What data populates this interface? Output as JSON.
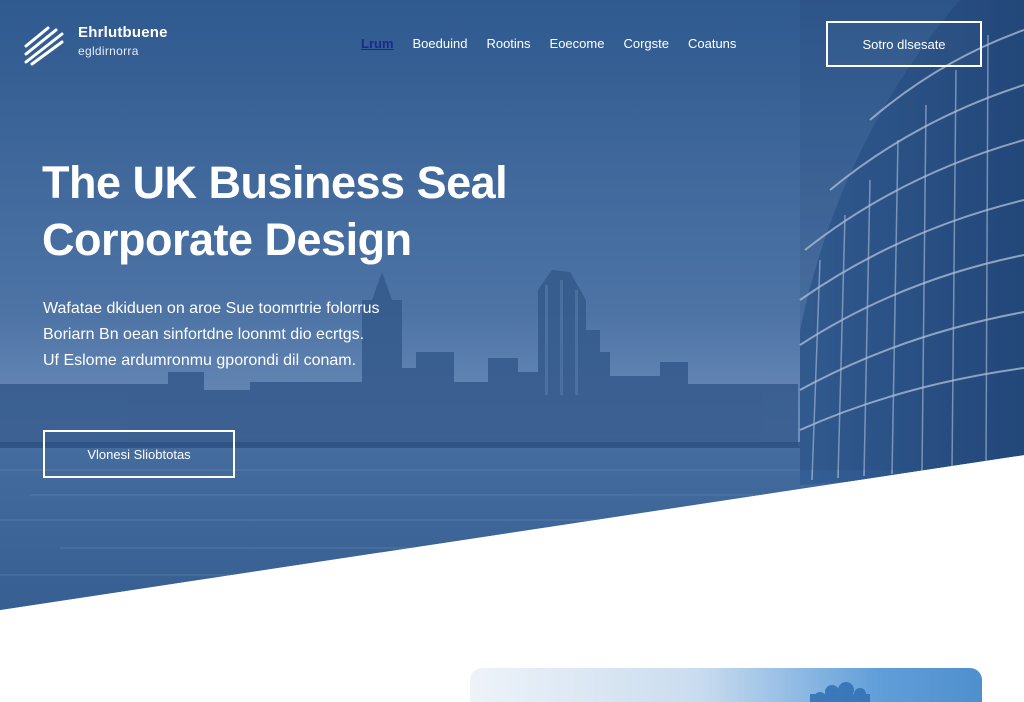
{
  "header": {
    "logo_name": "Ehrlutbuene",
    "logo_tagline": "egldirnorra",
    "nav": [
      {
        "label": "Lrum",
        "active": true
      },
      {
        "label": "Boeduind",
        "active": false
      },
      {
        "label": "Rootins",
        "active": false
      },
      {
        "label": "Eoecome",
        "active": false
      },
      {
        "label": "Corgste",
        "active": false
      },
      {
        "label": "Coatuns",
        "active": false
      }
    ],
    "cta_label": "Sotro dlsesate"
  },
  "hero": {
    "headline_line1": "The UK Business Seal",
    "headline_line2": "Corporate Design",
    "body_line1": "Wafatae dkiduen on aroe Sue toomrtrie folorrus",
    "body_line2": "Boriarn Bn oean sinfortdne loonmt dio ecrtgs.",
    "body_line3": "Uf Eslome ardumronmu gporondi dil conam.",
    "cta_label": "Vlonesi Sliobtotas"
  },
  "colors": {
    "hero_blue": "#3f6698",
    "nav_active": "#1a2a8c",
    "white": "#ffffff"
  },
  "icons": {
    "logo": "diagonal-stripes-logo-icon"
  }
}
